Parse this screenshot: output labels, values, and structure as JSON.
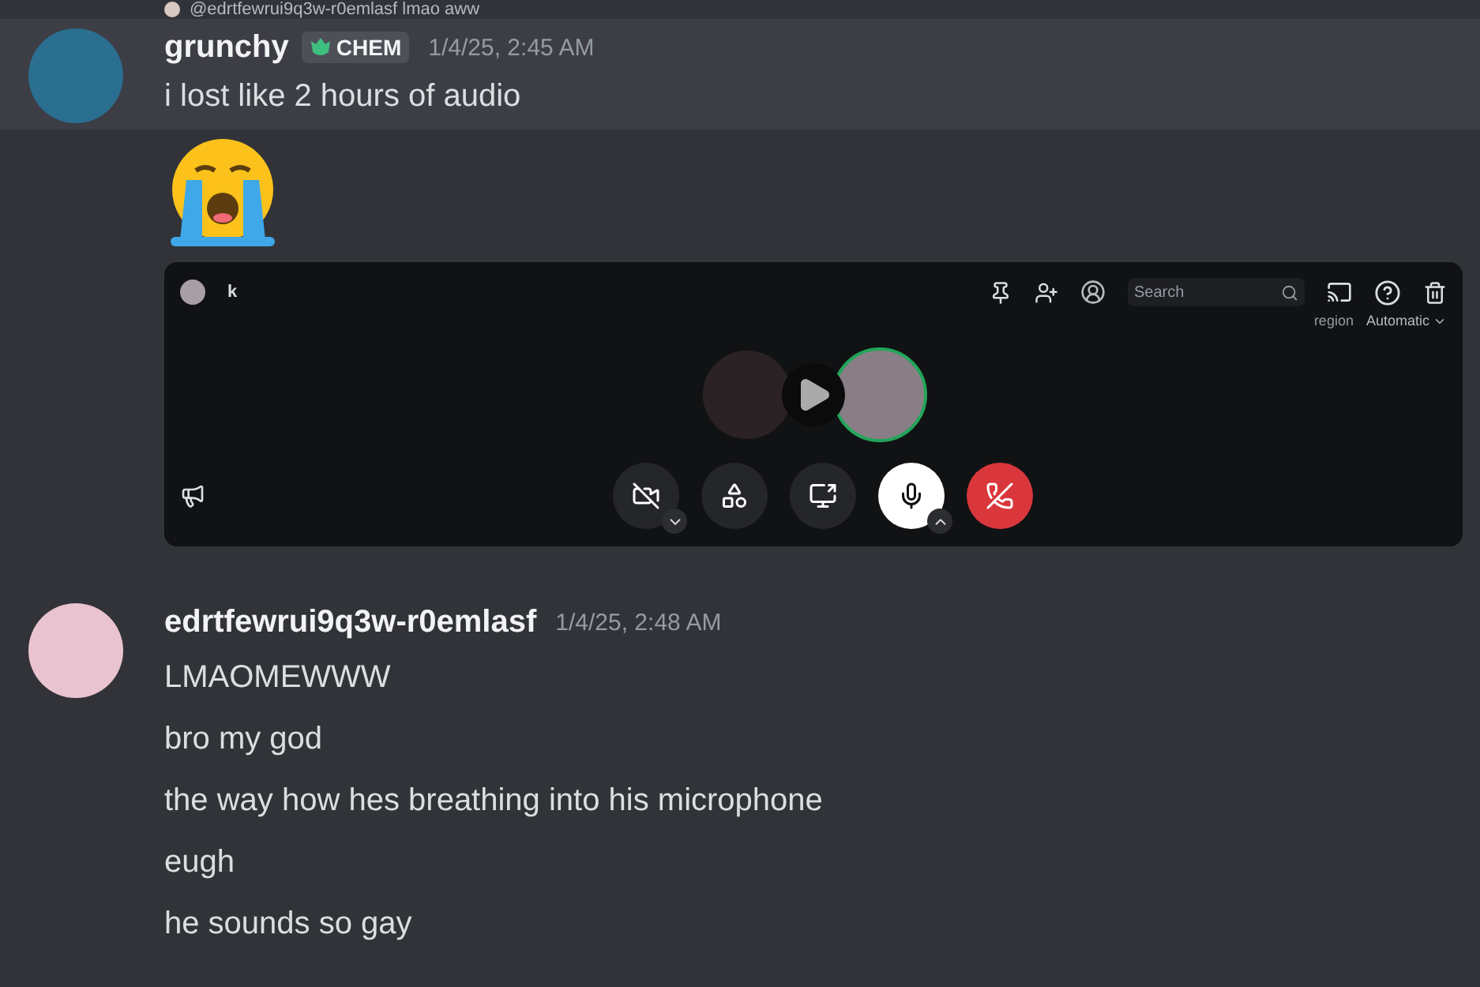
{
  "reply": {
    "text": "@edrtfewrui9q3w-r0emlasf lmao aww"
  },
  "messages": [
    {
      "username": "grunchy",
      "tag": "CHEM",
      "timestamp": "1/4/25, 2:45 AM",
      "highlighted": true,
      "lines": [
        "i lost like 2 hours of audio"
      ],
      "attachments": [
        {
          "kind": "emoji"
        },
        {
          "kind": "call",
          "user": "k",
          "search": {
            "placeholder": "Search"
          },
          "region_label": "region",
          "region_value": "Automatic",
          "participants": [
            {
              "speaking": false
            },
            {
              "speaking": true
            }
          ],
          "controls": [
            {
              "kind": "camera",
              "caret": {
                "kind": "down"
              }
            },
            {
              "kind": "activities"
            },
            {
              "kind": "share"
            },
            {
              "kind": "mic",
              "caret": {
                "kind": "up"
              }
            },
            {
              "kind": "hangup"
            }
          ]
        }
      ]
    },
    {
      "username": "edrtfewrui9q3w-r0emlasf",
      "timestamp": "1/4/25, 2:48 AM",
      "highlighted": false,
      "lines": [
        "LMAOMEWWW",
        "bro my god",
        "the way how hes breathing into his microphone",
        "eugh",
        "he sounds so gay"
      ]
    }
  ]
}
